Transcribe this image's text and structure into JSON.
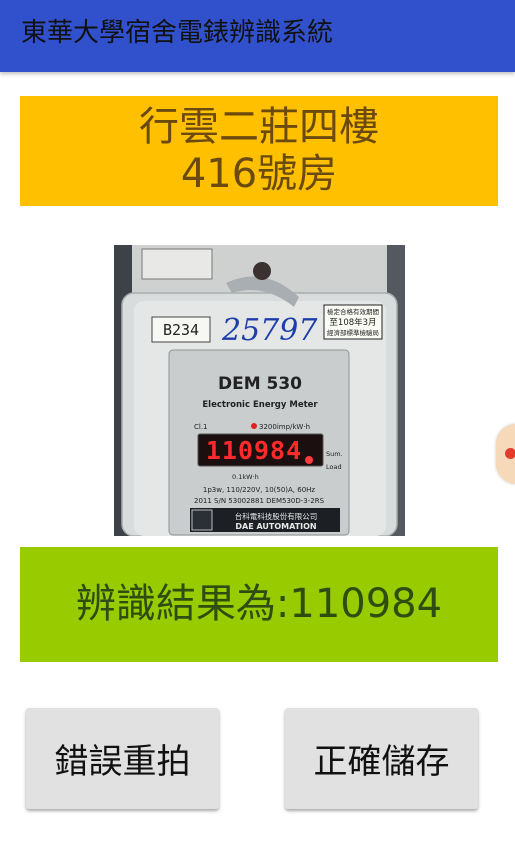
{
  "app": {
    "title": "東華大學宿舍電錶辨識系統",
    "accent_color": "#3151cc"
  },
  "room": {
    "building_floor": "行雲二莊四樓",
    "room_number": "416號房",
    "banner_color": "#ffc000"
  },
  "meter_photo": {
    "label_tag": "B234",
    "handwritten": "25797",
    "model": "DEM 530",
    "subtitle": "Electronic Energy Meter",
    "class_label": "Cl.1",
    "constant": "3200imp/kW·h",
    "display_value": "110984",
    "sum_label": "Sum.",
    "load_label": "Load",
    "resolution": "0.1kW·h",
    "spec_line": "1p3w, 110/220V, 10(50)A, 60Hz",
    "serial_line": "2011 S/N 53002881 DEM530D-3-2RS",
    "manufacturer_zh": "台科電科技股份有限公司",
    "manufacturer_en": "DAE AUTOMATION",
    "sticker_line1": "檢定合格有效期間",
    "sticker_line2": "至108年3月",
    "sticker_line3": "經濟部標準檢驗局"
  },
  "result": {
    "text": "辨識結果為:110984",
    "banner_color": "#99cc00"
  },
  "buttons": {
    "retake_label": "錯誤重拍",
    "save_label": "正確儲存"
  }
}
